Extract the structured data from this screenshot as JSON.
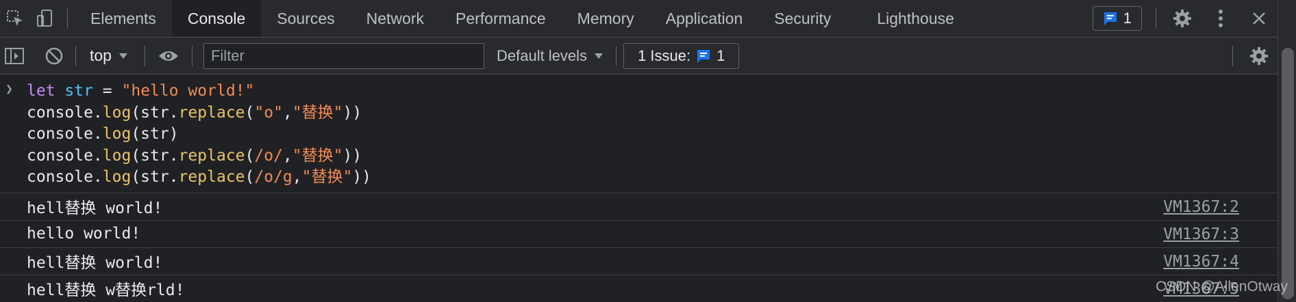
{
  "tabs": [
    "Elements",
    "Console",
    "Sources",
    "Network",
    "Performance",
    "Memory",
    "Application",
    "Security",
    "Lighthouse"
  ],
  "active_tab": "Console",
  "issues_badge_count": "1",
  "toolbar": {
    "context": "top",
    "filter_placeholder": "Filter",
    "levels_label": "Default levels",
    "issue_label": "1 Issue:",
    "issue_count": "1"
  },
  "code": {
    "line1": {
      "kw": "let",
      "var": "str",
      "eq": " = ",
      "str": "\"hello world!\""
    },
    "line2": {
      "a": "console.",
      "fn1": "log",
      "b": "(str.",
      "fn2": "replace",
      "c": "(",
      "s1": "\"o\"",
      "d": ",",
      "s2": "\"替换\"",
      "e": "))"
    },
    "line3": {
      "a": "console.",
      "fn1": "log",
      "b": "(str)"
    },
    "line4": {
      "a": "console.",
      "fn1": "log",
      "b": "(str.",
      "fn2": "replace",
      "c": "(",
      "s1": "/o/",
      "d": ",",
      "s2": "\"替换\"",
      "e": "))"
    },
    "line5": {
      "a": "console.",
      "fn1": "log",
      "b": "(str.",
      "fn2": "replace",
      "c": "(",
      "s1": "/o/g",
      "d": ",",
      "s2": "\"替换\"",
      "e": "))"
    }
  },
  "outputs": [
    {
      "text": "hell替换 world!",
      "source": "VM1367:2"
    },
    {
      "text": "hello world!",
      "source": "VM1367:3"
    },
    {
      "text": "hell替换 world!",
      "source": "VM1367:4"
    },
    {
      "text": "hell替换 w替换rld!",
      "source": "VM1367:5"
    }
  ],
  "watermark": "CSDN @AllenOtway",
  "colors": {
    "accent_blue": "#1a73e8",
    "string": "#f28b54",
    "keyword": "#c58af9",
    "variable": "#4fc1ff",
    "function": "#e9c46a"
  }
}
